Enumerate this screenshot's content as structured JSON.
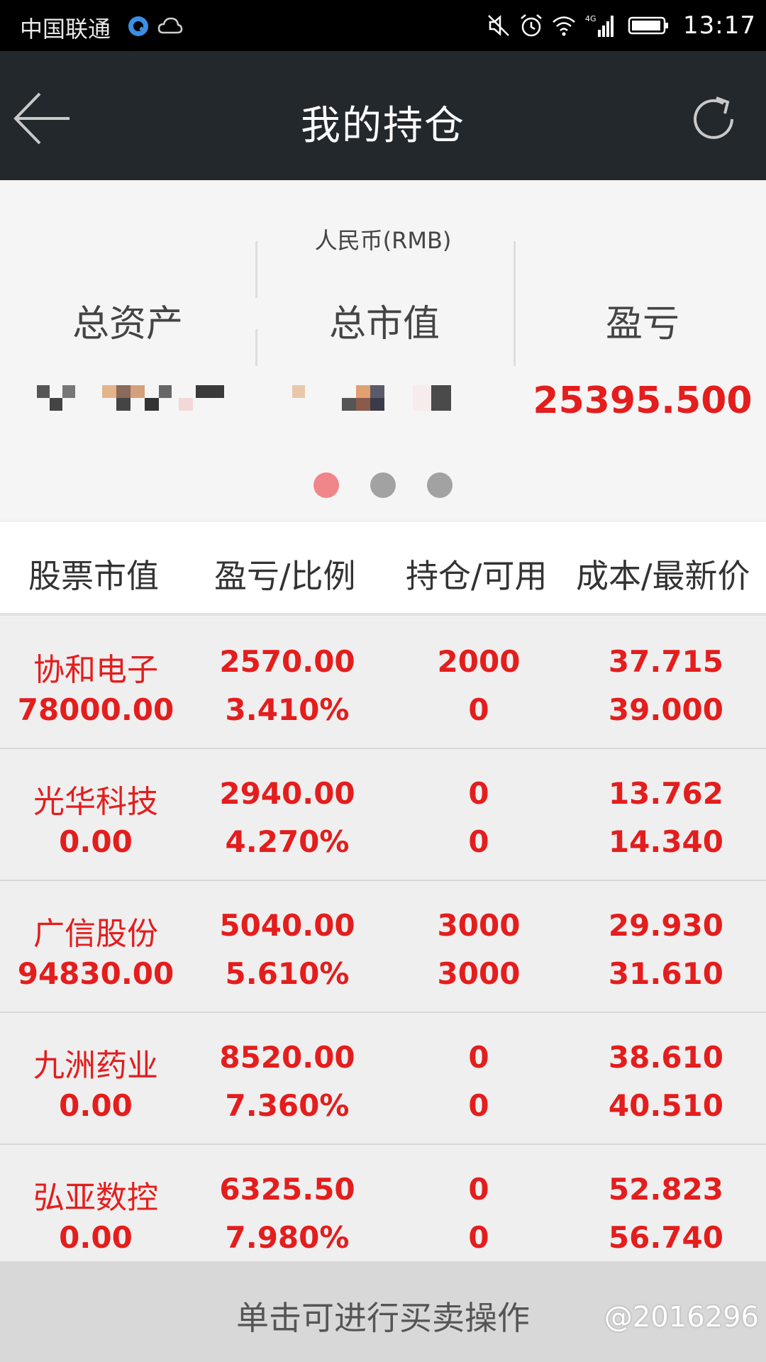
{
  "status_bar": {
    "carrier": "中国联通",
    "time": "13:17"
  },
  "header": {
    "title": "我的持仓"
  },
  "summary": {
    "currency": "人民币(RMB)",
    "total_assets_label": "总资产",
    "market_value_label": "总市值",
    "profit_label": "盈亏",
    "profit_value": "25395.500"
  },
  "columns": [
    "股票市值",
    "盈亏/比例",
    "持仓/可用",
    "成本/最新价"
  ],
  "rows": [
    {
      "name": "协和电子",
      "value": "78000.00",
      "pnl": "2570.00",
      "ratio": "3.410%",
      "hold": "2000",
      "avail": "0",
      "cost": "37.715",
      "price": "39.000"
    },
    {
      "name": "光华科技",
      "value": "0.00",
      "pnl": "2940.00",
      "ratio": "4.270%",
      "hold": "0",
      "avail": "0",
      "cost": "13.762",
      "price": "14.340"
    },
    {
      "name": "广信股份",
      "value": "94830.00",
      "pnl": "5040.00",
      "ratio": "5.610%",
      "hold": "3000",
      "avail": "3000",
      "cost": "29.930",
      "price": "31.610"
    },
    {
      "name": "九洲药业",
      "value": "0.00",
      "pnl": "8520.00",
      "ratio": "7.360%",
      "hold": "0",
      "avail": "0",
      "cost": "38.610",
      "price": "40.510"
    },
    {
      "name": "弘亚数控",
      "value": "0.00",
      "pnl": "6325.50",
      "ratio": "7.980%",
      "hold": "0",
      "avail": "0",
      "cost": "52.823",
      "price": "56.740"
    }
  ],
  "bottom_bar": {
    "label": "单击可进行买卖操作",
    "watermark": "@2016296"
  },
  "colors": {
    "accent_red": "#e41d1d",
    "header_bg": "#23282d",
    "dot_active": "#f0868a",
    "dot_inactive": "#a2a2a2"
  },
  "icons": {
    "back": "arrow-left-icon",
    "refresh": "refresh-icon"
  },
  "pager": {
    "total": 3,
    "active": 1
  }
}
